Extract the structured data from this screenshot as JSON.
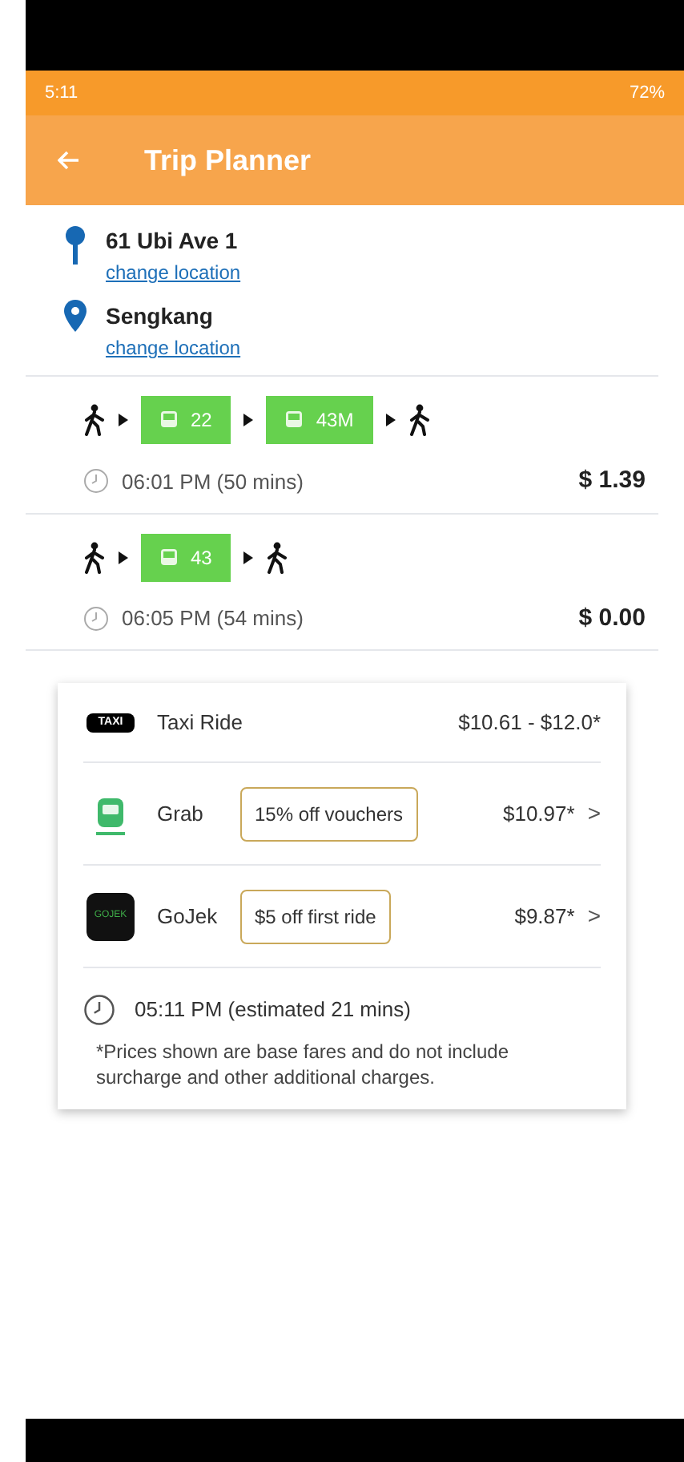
{
  "status_bar": {
    "time": "5:11",
    "battery": "72%"
  },
  "app_bar": {
    "title": "Trip Planner"
  },
  "locations": [
    {
      "kind": "origin",
      "name": "61 Ubi Ave 1",
      "link": "change location"
    },
    {
      "kind": "destination",
      "name": "Sengkang",
      "link": "change location"
    }
  ],
  "routes": [
    {
      "legs": [
        {
          "kind": "walk"
        },
        {
          "kind": "bus",
          "label": "22"
        },
        {
          "kind": "bus",
          "label": "43M"
        },
        {
          "kind": "walk"
        }
      ],
      "time": "06:01 PM (50 mins)",
      "fare": "$ 1.39"
    },
    {
      "legs": [
        {
          "kind": "walk"
        },
        {
          "kind": "bus",
          "label": "43"
        },
        {
          "kind": "walk"
        }
      ],
      "time": "06:05 PM (54 mins)",
      "fare": "$ 0.00"
    }
  ],
  "rides": [
    {
      "kind": "taxi",
      "logo_text": "TAXI",
      "name": "Taxi Ride",
      "price": "$10.61 - $12.0*"
    },
    {
      "kind": "grab",
      "name": "Grab",
      "promo": "15% off vouchers",
      "price": "$10.97*",
      "chevron": ">"
    },
    {
      "kind": "gojek",
      "logo_text": "GOJEK",
      "name": "GoJek",
      "promo": "$5 off first ride",
      "price": "$9.87*",
      "chevron": ">"
    }
  ],
  "ride_estimate": "05:11 PM (estimated 21 mins)",
  "disclaimer": "*Prices shown are base fares and do not include surcharge and other additional charges."
}
